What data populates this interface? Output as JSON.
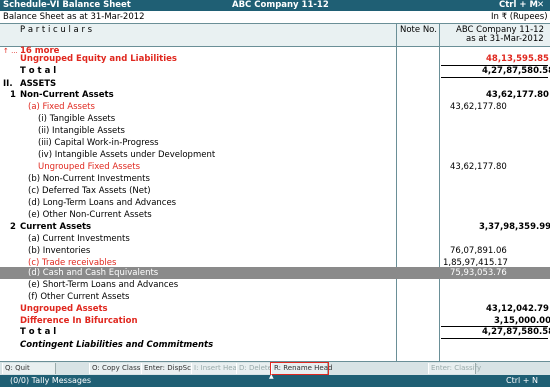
{
  "window": {
    "screen_title": "Schedule-VI Balance Sheet",
    "company": "ABC Company 11-12",
    "shortcut": "Ctrl + M",
    "close_glyph": "✕"
  },
  "subheader": {
    "left": "Balance Sheet as at 31-Mar-2012",
    "right": "In ₹ (Rupees)"
  },
  "columns": {
    "particulars": "P a r t i c u l a r s",
    "note_no": "Note No.",
    "company": "ABC Company 11-12",
    "as_at": "as at 31-Mar-2012"
  },
  "rows": {
    "more": "16 more",
    "more_marker": "↑ ...",
    "ungrouped_el": "Ungrouped Equity and Liabilities",
    "ungrouped_el_val": "48,13,595.85",
    "total1": "T o t a l",
    "total1_val": "4,27,87,580.58",
    "sec2_num": "II.",
    "assets": "ASSETS",
    "nca_num": "1",
    "nca": "Non-Current Assets",
    "nca_val": "43,62,177.80",
    "fixed": "(a) Fixed Assets",
    "fixed_val": "43,62,177.80",
    "tangible": "(i) Tangible Assets",
    "intangible": "(ii) Intangible Assets",
    "cwip": "(iii) Capital Work-in-Progress",
    "iaud": "(iv) Intangible Assets under Development",
    "ungrouped_fixed": "Ungrouped Fixed Assets",
    "ungrouped_fixed_val": "43,62,177.80",
    "nci": "(b) Non-Current Investments",
    "dta": "(c) Deferred Tax Assets (Net)",
    "ltla": "(d) Long-Term Loans and Advances",
    "onca": "(e) Other Non-Current Assets",
    "ca_num": "2",
    "ca": "Current Assets",
    "ca_val": "3,37,98,359.99",
    "ci": "(a) Current Investments",
    "inv": "(b) Inventories",
    "inv_val": "76,07,891.06",
    "tr": "(c) Trade receivables",
    "tr_val": "1,85,97,415.17",
    "cash": "(d) Cash and Cash Equivalents",
    "cash_val": "75,93,053.76",
    "stla": "(e) Short-Term Loans and Advances",
    "oca": "(f) Other Current Assets",
    "ungrouped_assets": "Ungrouped Assets",
    "ungrouped_assets_val": "43,12,042.79",
    "diff": "Difference In Bifurcation",
    "diff_val": "3,15,000.00",
    "total2": "T o t a l",
    "total2_val": "4,27,87,580.58",
    "contingent": "Contingent Liabilities and Commitments"
  },
  "buttons": {
    "quit": "Q: Quit",
    "copy_classify": "O: Copy Classify",
    "enter_dispsch": "Enter: DispSch",
    "insert_head": "I: Insert Head",
    "delete_head": "D: Delete Head",
    "rename_head": "R: Rename Head",
    "enter_classify": "Enter: Classify"
  },
  "status": {
    "messages": "(0/0) Tally Messages",
    "shortcut": "Ctrl + N",
    "up_arrow": "▲"
  },
  "colors": {
    "title_bg": "#1f5f74",
    "accent_red": "#e0281f",
    "selected_row_bg": "#8a8a8a"
  }
}
